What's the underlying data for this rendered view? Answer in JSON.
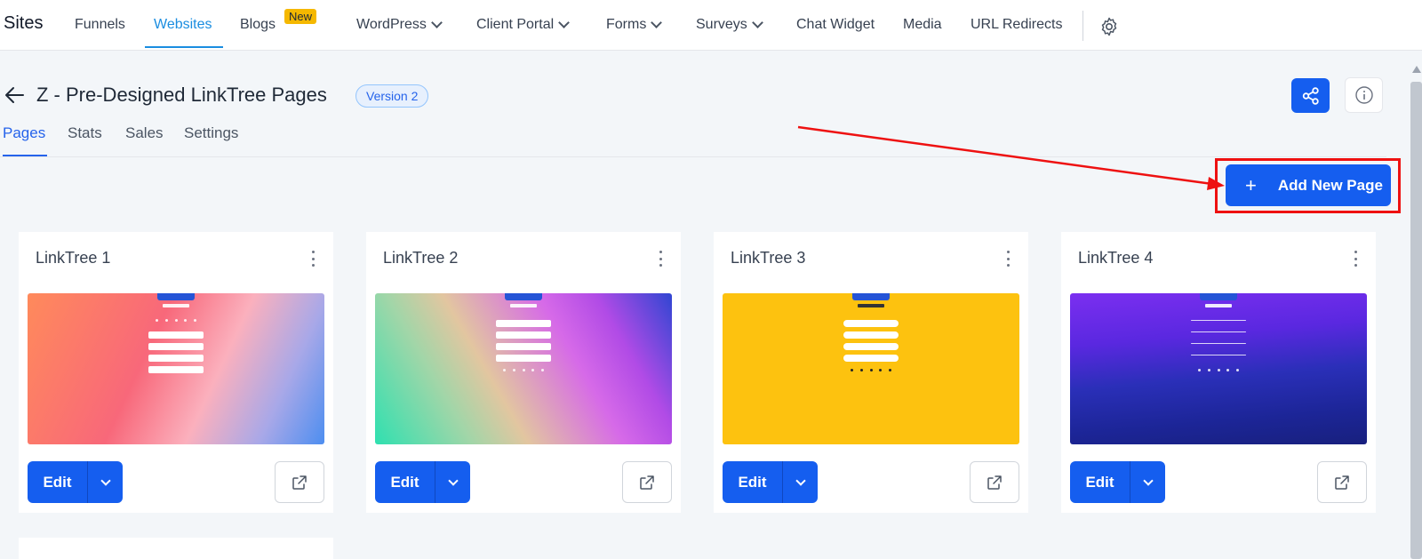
{
  "app": {
    "brand": "Sites"
  },
  "nav": {
    "items": [
      {
        "label": "Funnels"
      },
      {
        "label": "Websites"
      },
      {
        "label": "Blogs",
        "badge": "New"
      },
      {
        "label": "WordPress"
      },
      {
        "label": "Client Portal"
      },
      {
        "label": "Forms"
      },
      {
        "label": "Surveys"
      },
      {
        "label": "Chat Widget"
      },
      {
        "label": "Media"
      },
      {
        "label": "URL Redirects"
      }
    ],
    "active": "Websites",
    "settings_icon": "gear-icon"
  },
  "header": {
    "title": "Z - Pre-Designed LinkTree Pages",
    "version": "Version 2"
  },
  "tabs": [
    {
      "label": "Pages"
    },
    {
      "label": "Stats"
    },
    {
      "label": "Sales"
    },
    {
      "label": "Settings"
    }
  ],
  "actions": {
    "add_page": "Add New Page"
  },
  "cards": [
    {
      "title": "LinkTree 1",
      "edit": "Edit"
    },
    {
      "title": "LinkTree 2",
      "edit": "Edit"
    },
    {
      "title": "LinkTree 3",
      "edit": "Edit"
    },
    {
      "title": "LinkTree 4",
      "edit": "Edit"
    }
  ],
  "colors": {
    "primary": "#155eef",
    "nav_active": "#1a8de0",
    "annotation": "#ee1111",
    "new_badge": "#f5b800"
  }
}
